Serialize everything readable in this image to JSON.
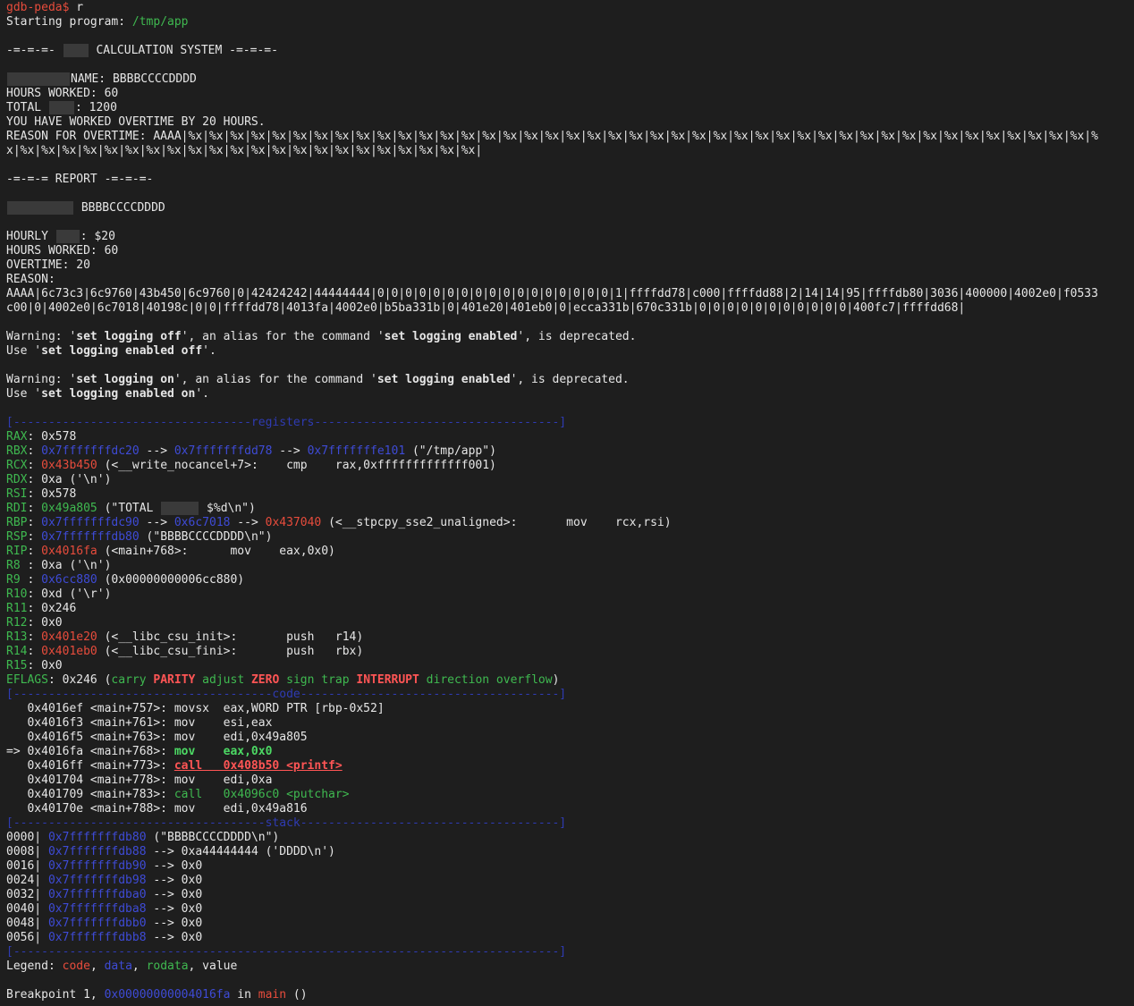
{
  "colors": {
    "background": "#1e1e1e",
    "text": "#e6e6e6",
    "code": "#e74c3c",
    "data": "#3e4bd6",
    "rodata": "#3fb950",
    "redaction": "#3a3a3a"
  },
  "lines": [
    {
      "redact": false,
      "spans": [
        {
          "t": "gdb-peda$",
          "c": "r"
        },
        {
          "t": " r",
          "c": "w"
        }
      ]
    },
    {
      "spans": [
        {
          "t": "Starting program: ",
          "c": "w"
        },
        {
          "t": "/tmp/app",
          "c": "g"
        }
      ]
    },
    {
      "spans": []
    },
    {
      "spans": [
        {
          "t": "-=-=-=- ",
          "c": "w"
        },
        {
          "redact": 28
        },
        {
          "t": " CALCULATION SYSTEM -=-=-=-",
          "c": "w"
        }
      ]
    },
    {
      "spans": []
    },
    {
      "spans": [
        {
          "redact": 70
        },
        {
          "t": "NAME: BBBBCCCCDDDD",
          "c": "w"
        }
      ]
    },
    {
      "spans": [
        {
          "t": "HOURS WORKED: 60",
          "c": "w"
        }
      ]
    },
    {
      "spans": [
        {
          "t": "TOTAL ",
          "c": "w"
        },
        {
          "redact": 28
        },
        {
          "t": ": 1200",
          "c": "w"
        }
      ]
    },
    {
      "spans": [
        {
          "t": "YOU HAVE WORKED OVERTIME BY 20 HOURS.",
          "c": "w"
        }
      ]
    },
    {
      "spans": [
        {
          "t": "REASON FOR OVERTIME: AAAA|%x|%x|%x|%x|%x|%x|%x|%x|%x|%x|%x|%x|%x|%x|%x|%x|%x|%x|%x|%x|%x|%x|%x|%x|%x|%x|%x|%x|%x|%x|%x|%x|%x|%x|%x|%x|%x|%x|%x|%x|%x|%x|%x|%",
          "c": "w"
        }
      ]
    },
    {
      "spans": [
        {
          "t": "x|%x|%x|%x|%x|%x|%x|%x|%x|%x|%x|%x|%x|%x|%x|%x|%x|%x|%x|%x|%x|%x|%x|",
          "c": "w"
        }
      ]
    },
    {
      "spans": []
    },
    {
      "spans": [
        {
          "t": "-=-=-= REPORT -=-=-=-",
          "c": "w"
        }
      ]
    },
    {
      "spans": []
    },
    {
      "spans": [
        {
          "redact": 74
        },
        {
          "t": " BBBBCCCCDDDD",
          "c": "w"
        }
      ]
    },
    {
      "spans": []
    },
    {
      "spans": [
        {
          "t": "HOURLY ",
          "c": "w"
        },
        {
          "redact": 26
        },
        {
          "t": ": $20",
          "c": "w"
        }
      ]
    },
    {
      "spans": [
        {
          "t": "HOURS WORKED: 60",
          "c": "w"
        }
      ]
    },
    {
      "spans": [
        {
          "t": "OVERTIME: 20",
          "c": "w"
        }
      ]
    },
    {
      "spans": [
        {
          "t": "REASON:",
          "c": "w"
        }
      ]
    },
    {
      "spans": [
        {
          "t": "AAAA|6c73c3|6c9760|43b450|6c9760|0|42424242|44444444|0|0|0|0|0|0|0|0|0|0|0|0|0|0|0|0|0|1|ffffdd78|c000|ffffdd88|2|14|14|95|ffffdb80|3036|400000|4002e0|f0533",
          "c": "w"
        }
      ]
    },
    {
      "spans": [
        {
          "t": "c00|0|4002e0|6c7018|40198c|0|0|ffffdd78|4013fa|4002e0|b5ba331b|0|401e20|401eb0|0|ecca331b|670c331b|0|0|0|0|0|0|0|0|0|0|0|400fc7|ffffdd68|",
          "c": "w"
        }
      ]
    },
    {
      "spans": []
    },
    {
      "spans": [
        {
          "t": "Warning: '",
          "c": "w"
        },
        {
          "t": "set logging off",
          "c": "w",
          "bold": true
        },
        {
          "t": "', an alias for the command '",
          "c": "w"
        },
        {
          "t": "set logging enabled",
          "c": "w",
          "bold": true
        },
        {
          "t": "', is deprecated.",
          "c": "w"
        }
      ]
    },
    {
      "spans": [
        {
          "t": "Use '",
          "c": "w"
        },
        {
          "t": "set logging enabled off",
          "c": "w",
          "bold": true
        },
        {
          "t": "'.",
          "c": "w"
        }
      ]
    },
    {
      "spans": []
    },
    {
      "spans": [
        {
          "t": "Warning: '",
          "c": "w"
        },
        {
          "t": "set logging on",
          "c": "w",
          "bold": true
        },
        {
          "t": "', an alias for the command '",
          "c": "w"
        },
        {
          "t": "set logging enabled",
          "c": "w",
          "bold": true
        },
        {
          "t": "', is deprecated.",
          "c": "w"
        }
      ]
    },
    {
      "spans": [
        {
          "t": "Use '",
          "c": "w"
        },
        {
          "t": "set logging enabled on",
          "c": "w",
          "bold": true
        },
        {
          "t": "'.",
          "c": "w"
        }
      ]
    },
    {
      "spans": []
    },
    {
      "spans": [
        {
          "t": "[----------------------------------registers-----------------------------------]",
          "c": "bl"
        }
      ]
    },
    {
      "spans": [
        {
          "t": "RAX",
          "c": "g"
        },
        {
          "t": ": 0x578",
          "c": "w"
        }
      ]
    },
    {
      "spans": [
        {
          "t": "RBX",
          "c": "g"
        },
        {
          "t": ": ",
          "c": "w"
        },
        {
          "t": "0x7fffffffdc20",
          "c": "b"
        },
        {
          "t": " --> ",
          "c": "w"
        },
        {
          "t": "0x7fffffffdd78",
          "c": "b"
        },
        {
          "t": " --> ",
          "c": "w"
        },
        {
          "t": "0x7fffffffe101",
          "c": "b"
        },
        {
          "t": " (\"/tmp/app\")",
          "c": "w"
        }
      ]
    },
    {
      "spans": [
        {
          "t": "RCX",
          "c": "g"
        },
        {
          "t": ": ",
          "c": "w"
        },
        {
          "t": "0x43b450",
          "c": "r"
        },
        {
          "t": " (<__write_nocancel+7>:    cmp    rax,0xfffffffffffff001)",
          "c": "w"
        }
      ]
    },
    {
      "spans": [
        {
          "t": "RDX",
          "c": "g"
        },
        {
          "t": ": 0xa ('\\n')",
          "c": "w"
        }
      ]
    },
    {
      "spans": [
        {
          "t": "RSI",
          "c": "g"
        },
        {
          "t": ": 0x578",
          "c": "w"
        }
      ]
    },
    {
      "spans": [
        {
          "t": "RDI",
          "c": "g"
        },
        {
          "t": ": ",
          "c": "w"
        },
        {
          "t": "0x49a805",
          "c": "g"
        },
        {
          "t": " (\"TOTAL ",
          "c": "w"
        },
        {
          "redact": 42
        },
        {
          "t": " $%d\\n\")",
          "c": "w"
        }
      ]
    },
    {
      "spans": [
        {
          "t": "RBP",
          "c": "g"
        },
        {
          "t": ": ",
          "c": "w"
        },
        {
          "t": "0x7fffffffdc90",
          "c": "b"
        },
        {
          "t": " --> ",
          "c": "w"
        },
        {
          "t": "0x6c7018",
          "c": "b"
        },
        {
          "t": " --> ",
          "c": "w"
        },
        {
          "t": "0x437040",
          "c": "r"
        },
        {
          "t": " (<__stpcpy_sse2_unaligned>:       mov    rcx,rsi)",
          "c": "w"
        }
      ]
    },
    {
      "spans": [
        {
          "t": "RSP",
          "c": "g"
        },
        {
          "t": ": ",
          "c": "w"
        },
        {
          "t": "0x7fffffffdb80",
          "c": "b"
        },
        {
          "t": " (\"BBBBCCCCDDDD\\n\")",
          "c": "w"
        }
      ]
    },
    {
      "spans": [
        {
          "t": "RIP",
          "c": "g"
        },
        {
          "t": ": ",
          "c": "w"
        },
        {
          "t": "0x4016fa",
          "c": "r"
        },
        {
          "t": " (<main+768>:      mov    eax,0x0)",
          "c": "w"
        }
      ]
    },
    {
      "spans": [
        {
          "t": "R8 ",
          "c": "g"
        },
        {
          "t": ": 0xa ('\\n')",
          "c": "w"
        }
      ]
    },
    {
      "spans": [
        {
          "t": "R9 ",
          "c": "g"
        },
        {
          "t": ": ",
          "c": "w"
        },
        {
          "t": "0x6cc880",
          "c": "b"
        },
        {
          "t": " (0x00000000006cc880)",
          "c": "w"
        }
      ]
    },
    {
      "spans": [
        {
          "t": "R10",
          "c": "g"
        },
        {
          "t": ": 0xd ('\\r')",
          "c": "w"
        }
      ]
    },
    {
      "spans": [
        {
          "t": "R11",
          "c": "g"
        },
        {
          "t": ": 0x246",
          "c": "w"
        }
      ]
    },
    {
      "spans": [
        {
          "t": "R12",
          "c": "g"
        },
        {
          "t": ": 0x0",
          "c": "w"
        }
      ]
    },
    {
      "spans": [
        {
          "t": "R13",
          "c": "g"
        },
        {
          "t": ": ",
          "c": "w"
        },
        {
          "t": "0x401e20",
          "c": "r"
        },
        {
          "t": " (<__libc_csu_init>:       push   r14)",
          "c": "w"
        }
      ]
    },
    {
      "spans": [
        {
          "t": "R14",
          "c": "g"
        },
        {
          "t": ": ",
          "c": "w"
        },
        {
          "t": "0x401eb0",
          "c": "r"
        },
        {
          "t": " (<__libc_csu_fini>:       push   rbx)",
          "c": "w"
        }
      ]
    },
    {
      "spans": [
        {
          "t": "R15",
          "c": "g"
        },
        {
          "t": ": 0x0",
          "c": "w"
        }
      ]
    },
    {
      "spans": [
        {
          "t": "EFLAGS",
          "c": "g"
        },
        {
          "t": ": 0x246 (",
          "c": "w"
        },
        {
          "t": "carry ",
          "c": "g"
        },
        {
          "t": "PARITY",
          "c": "rb"
        },
        {
          "t": " adjust ",
          "c": "g"
        },
        {
          "t": "ZERO",
          "c": "rb"
        },
        {
          "t": " sign trap ",
          "c": "g"
        },
        {
          "t": "INTERRUPT",
          "c": "rb"
        },
        {
          "t": " direction overflow",
          "c": "g"
        },
        {
          "t": ")",
          "c": "w"
        }
      ]
    },
    {
      "spans": [
        {
          "t": "[-------------------------------------code-------------------------------------]",
          "c": "bl"
        }
      ]
    },
    {
      "spans": [
        {
          "t": "   0x4016ef <main+757>: movsx  eax,WORD PTR [rbp-0x52]",
          "c": "w"
        }
      ]
    },
    {
      "spans": [
        {
          "t": "   0x4016f3 <main+761>: mov    esi,eax",
          "c": "w"
        }
      ]
    },
    {
      "spans": [
        {
          "t": "   0x4016f5 <main+763>: mov    edi,0x49a805",
          "c": "w"
        }
      ]
    },
    {
      "spans": [
        {
          "t": "=> 0x4016fa <main+768>: ",
          "c": "w"
        },
        {
          "t": "mov    eax,0x0",
          "c": "gb"
        }
      ]
    },
    {
      "spans": [
        {
          "t": "   0x4016ff <main+773>: ",
          "c": "w"
        },
        {
          "t": "call   0x408b50 <printf>",
          "c": "rb",
          "ul": true
        }
      ]
    },
    {
      "spans": [
        {
          "t": "   0x401704 <main+778>: mov    edi,0xa",
          "c": "w"
        }
      ]
    },
    {
      "spans": [
        {
          "t": "   0x401709 <main+783>: ",
          "c": "w"
        },
        {
          "t": "call   0x4096c0 <putchar>",
          "c": "g"
        }
      ]
    },
    {
      "spans": [
        {
          "t": "   0x40170e <main+788>: mov    edi,0x49a816",
          "c": "w"
        }
      ]
    },
    {
      "spans": [
        {
          "t": "[------------------------------------stack-------------------------------------]",
          "c": "bl"
        }
      ]
    },
    {
      "spans": [
        {
          "t": "0000| ",
          "c": "w"
        },
        {
          "t": "0x7fffffffdb80",
          "c": "b"
        },
        {
          "t": " (\"BBBBCCCCDDDD\\n\")",
          "c": "w"
        }
      ]
    },
    {
      "spans": [
        {
          "t": "0008| ",
          "c": "w"
        },
        {
          "t": "0x7fffffffdb88",
          "c": "b"
        },
        {
          "t": " --> 0xa44444444 ('DDDD\\n')",
          "c": "w"
        }
      ]
    },
    {
      "spans": [
        {
          "t": "0016| ",
          "c": "w"
        },
        {
          "t": "0x7fffffffdb90",
          "c": "b"
        },
        {
          "t": " --> 0x0",
          "c": "w"
        }
      ]
    },
    {
      "spans": [
        {
          "t": "0024| ",
          "c": "w"
        },
        {
          "t": "0x7fffffffdb98",
          "c": "b"
        },
        {
          "t": " --> 0x0",
          "c": "w"
        }
      ]
    },
    {
      "spans": [
        {
          "t": "0032| ",
          "c": "w"
        },
        {
          "t": "0x7fffffffdba0",
          "c": "b"
        },
        {
          "t": " --> 0x0",
          "c": "w"
        }
      ]
    },
    {
      "spans": [
        {
          "t": "0040| ",
          "c": "w"
        },
        {
          "t": "0x7fffffffdba8",
          "c": "b"
        },
        {
          "t": " --> 0x0",
          "c": "w"
        }
      ]
    },
    {
      "spans": [
        {
          "t": "0048| ",
          "c": "w"
        },
        {
          "t": "0x7fffffffdbb0",
          "c": "b"
        },
        {
          "t": " --> 0x0",
          "c": "w"
        }
      ]
    },
    {
      "spans": [
        {
          "t": "0056| ",
          "c": "w"
        },
        {
          "t": "0x7fffffffdbb8",
          "c": "b"
        },
        {
          "t": " --> 0x0",
          "c": "w"
        }
      ]
    },
    {
      "spans": [
        {
          "t": "[------------------------------------------------------------------------------]",
          "c": "bl"
        }
      ]
    },
    {
      "spans": [
        {
          "t": "Legend: ",
          "c": "w"
        },
        {
          "t": "code",
          "c": "r"
        },
        {
          "t": ", ",
          "c": "w"
        },
        {
          "t": "data",
          "c": "b"
        },
        {
          "t": ", ",
          "c": "w"
        },
        {
          "t": "rodata",
          "c": "g"
        },
        {
          "t": ", value",
          "c": "w"
        }
      ]
    },
    {
      "spans": []
    },
    {
      "spans": [
        {
          "t": "Breakpoint 1, ",
          "c": "w"
        },
        {
          "t": "0x00000000004016fa",
          "c": "b"
        },
        {
          "t": " in ",
          "c": "w"
        },
        {
          "t": "main",
          "c": "r"
        },
        {
          "t": " ()",
          "c": "w"
        }
      ]
    }
  ]
}
